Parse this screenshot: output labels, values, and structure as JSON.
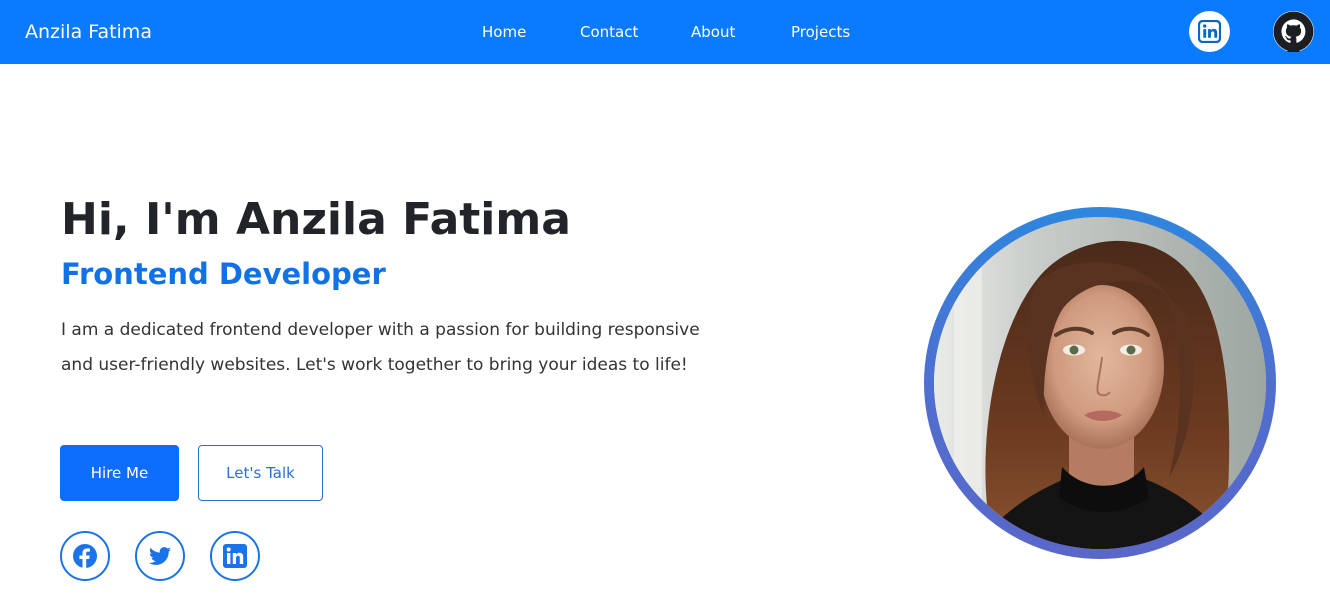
{
  "navbar": {
    "brand": "Anzila Fatima",
    "links": [
      {
        "label": "Home"
      },
      {
        "label": "Contact"
      },
      {
        "label": "About"
      },
      {
        "label": "Projects"
      }
    ],
    "social_icons": [
      "linkedin-icon",
      "github-icon"
    ]
  },
  "hero": {
    "title": "Hi, I'm Anzila Fatima",
    "role": "Frontend Developer",
    "description": "I am a dedicated frontend developer with a passion for building responsive and user-friendly websites. Let's work together to bring your ideas to life!",
    "primary_button": "Hire Me",
    "secondary_button": "Let's Talk",
    "social_icons": [
      "facebook-icon",
      "twitter-icon",
      "linkedin-icon"
    ]
  },
  "colors": {
    "navbar_bg": "#0a7bff",
    "accent": "#0d6efd",
    "role_text": "#1172e8",
    "heading": "#212529"
  }
}
